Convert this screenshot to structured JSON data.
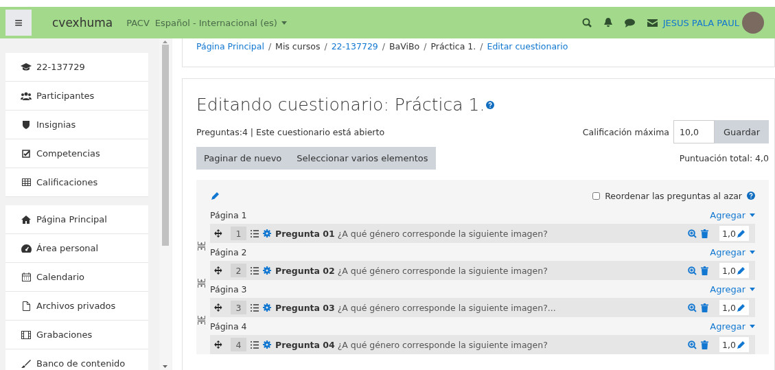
{
  "navbar": {
    "menu_icon": "≡",
    "site_name": "cvexhuma",
    "links": [
      "PACV"
    ],
    "language": "Español - Internacional (es)",
    "user_name": "JESUS PALA PAUL"
  },
  "sidebar": {
    "sections": [
      [
        {
          "label": "22-137729"
        },
        {
          "label": "Participantes"
        },
        {
          "label": "Insignias"
        },
        {
          "label": "Competencias"
        },
        {
          "label": "Calificaciones"
        }
      ],
      [
        {
          "label": "Página Principal"
        },
        {
          "label": "Área personal"
        },
        {
          "label": "Calendario"
        },
        {
          "label": "Archivos privados"
        },
        {
          "label": "Grabaciones"
        },
        {
          "label": "Banco de contenido"
        }
      ]
    ]
  },
  "breadcrumb": [
    {
      "label": "Página Principal",
      "link": true
    },
    {
      "separator": "/",
      "label": "Mis cursos",
      "link": false
    },
    {
      "separator": "/",
      "label": "22-137729",
      "link": true
    },
    {
      "separator": "/",
      "label": "BaViBo",
      "link": false
    },
    {
      "separator": "/",
      "label": "Práctica 1.",
      "link": false
    },
    {
      "separator": "/",
      "label": "Editar cuestionario",
      "link": true
    }
  ],
  "heading": "Editando cuestionario: Práctica 1.",
  "info": "Preguntas:4 | Este cuestionario está abierto",
  "max_grade": {
    "label": "Calificación máxima",
    "value": "10,0",
    "button": "Guardar"
  },
  "toolbar_buttons": [
    "Paginar de nuevo",
    "Seleccionar varios elementos"
  ],
  "total": "Puntuación total: 4,0",
  "shuffle": {
    "label": "Reordenar las preguntas al azar",
    "checked": false
  },
  "pages": [
    {
      "title": "Página 1",
      "add": "Agregar",
      "question": {
        "number": "1",
        "text": "**Pregunta 01** ¿A qué género corresponde la siguiente imagen?",
        "mark": "1,0"
      }
    },
    {
      "title": "Página 2",
      "add": "Agregar",
      "question": {
        "number": "2",
        "text": "**Pregunta 02** ¿A qué género corresponde la siguiente imagen?",
        "mark": "1,0"
      }
    },
    {
      "title": "Página 3",
      "add": "Agregar",
      "question": {
        "number": "3",
        "text": "**Pregunta 03** ¿A qué género corresponde la siguiente imagen?...",
        "mark": "1,0"
      }
    },
    {
      "title": "Página 4",
      "add": "Agregar",
      "question": {
        "number": "4",
        "text": "**Pregunta 04** ¿A qué género corresponde la siguiente imagen?",
        "mark": "1,0"
      }
    }
  ]
}
